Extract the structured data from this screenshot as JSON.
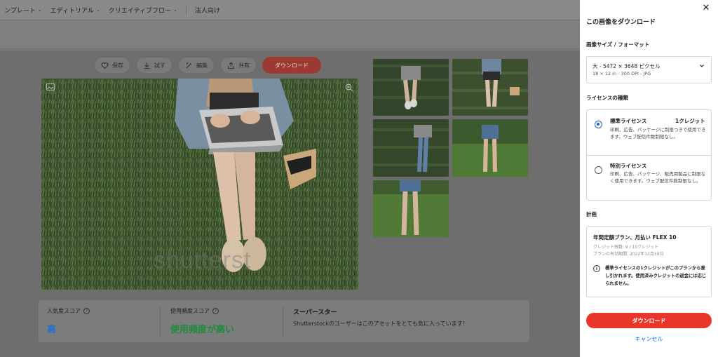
{
  "nav": {
    "items": [
      {
        "label": "ンプレート",
        "chevron": true
      },
      {
        "label": "エディトリアル",
        "chevron": true
      },
      {
        "label": "クリエイティブフロー",
        "chevron": true
      },
      {
        "label": "法人向け",
        "chevron": false
      }
    ]
  },
  "actions": {
    "save": "保存",
    "try": "試す",
    "edit": "編集",
    "share": "共有",
    "download": "ダウンロード"
  },
  "image": {
    "watermark": "shutterst"
  },
  "scores": {
    "popularity_label": "人気度スコア",
    "popularity_value": "高",
    "popularity_color": "#1f6fd6",
    "usage_label": "使用頻度スコア",
    "usage_value": "使用頻度が高い",
    "usage_color": "#1e8a3a",
    "superstar_title": "スーパースター",
    "superstar_desc": "Shutterstockのユーザーはこのアセットをとても気に入っています！"
  },
  "panel": {
    "close_icon": "close-icon",
    "title": "この画像をダウンロード",
    "size_section": "画像サイズ / フォーマット",
    "size_main": "大 - 5472 × 3648 ピクセル",
    "size_sub": "18 × 12 in - 300 DPI - JPG",
    "license_section": "ライセンスの種類",
    "licenses": [
      {
        "name": "標準ライセンス",
        "credit": "1クレジット",
        "desc": "印刷、広告、パッケージに制限つきで使用できます。ウェブ配信件数制限なし。",
        "selected": true
      },
      {
        "name": "特別ライセンス",
        "credit": "",
        "desc": "印刷、広告、パッケージ、販売用製品に制限なく使用できます。ウェブ配信件数制限なし。",
        "selected": false
      }
    ],
    "plan_section": "計画",
    "plan_name": "年間定額プラン、月払い FLEX 10",
    "plan_credits": "クレジット残数: 9 / 10クレジット",
    "plan_expiry": "プランの有効期間: 2022年12月19日",
    "plan_notice": "標準ライセンスの1クレジットがこのプランから差し引かれます。使用済みクレジットの返金には応じられません。",
    "download": "ダウンロード",
    "cancel": "キャンセル",
    "accent_color": "#e8362b",
    "link_color": "#1a5fd4"
  }
}
